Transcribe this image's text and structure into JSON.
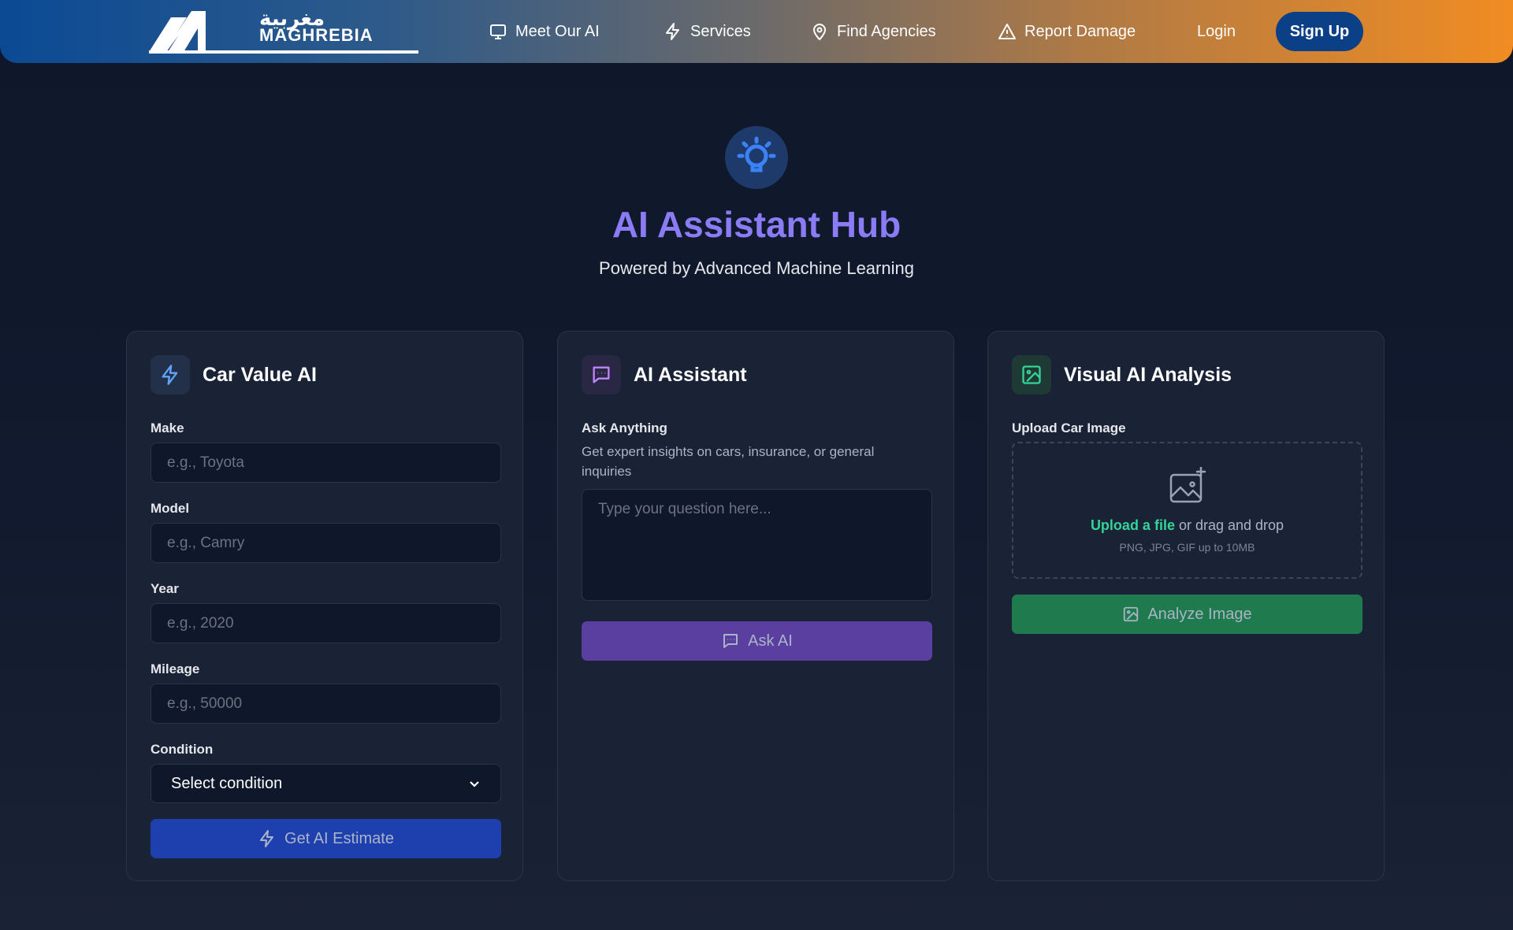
{
  "brand": {
    "name": "MAGHREBIA",
    "arabic": "مغربية"
  },
  "nav": {
    "items": [
      {
        "label": "Meet Our AI",
        "icon": "monitor-icon"
      },
      {
        "label": "Services",
        "icon": "lightning-icon"
      },
      {
        "label": "Find Agencies",
        "icon": "location-pin-icon"
      },
      {
        "label": "Report Damage",
        "icon": "warning-triangle-icon"
      }
    ],
    "login": "Login",
    "signup": "Sign Up"
  },
  "hero": {
    "icon": "lightbulb-icon",
    "title": "AI Assistant Hub",
    "subtitle": "Powered by Advanced Machine Learning"
  },
  "car_value": {
    "title": "Car Value AI",
    "icon": "lightning-icon",
    "fields": {
      "make": {
        "label": "Make",
        "placeholder": "e.g., Toyota"
      },
      "model": {
        "label": "Model",
        "placeholder": "e.g., Camry"
      },
      "year": {
        "label": "Year",
        "placeholder": "e.g., 2020"
      },
      "mileage": {
        "label": "Mileage",
        "placeholder": "e.g., 50000"
      },
      "condition": {
        "label": "Condition",
        "value": "Select condition"
      }
    },
    "button": "Get AI Estimate"
  },
  "assistant": {
    "title": "AI Assistant",
    "icon": "chat-bubble-icon",
    "label": "Ask Anything",
    "hint": "Get expert insights on cars, insurance, or general inquiries",
    "placeholder": "Type your question here...",
    "button": "Ask AI"
  },
  "visual": {
    "title": "Visual AI Analysis",
    "icon": "image-icon",
    "label": "Upload Car Image",
    "upload_link": "Upload a file",
    "upload_rest": "or drag and drop",
    "note": "PNG, JPG, GIF up to 10MB",
    "button": "Analyze Image"
  },
  "colors": {
    "accent_purple": "#8b7cf6",
    "accent_blue": "#1e40af",
    "accent_green": "#1f7a4d",
    "ask_purple": "#5b3fa0",
    "background": "#0f172a"
  }
}
